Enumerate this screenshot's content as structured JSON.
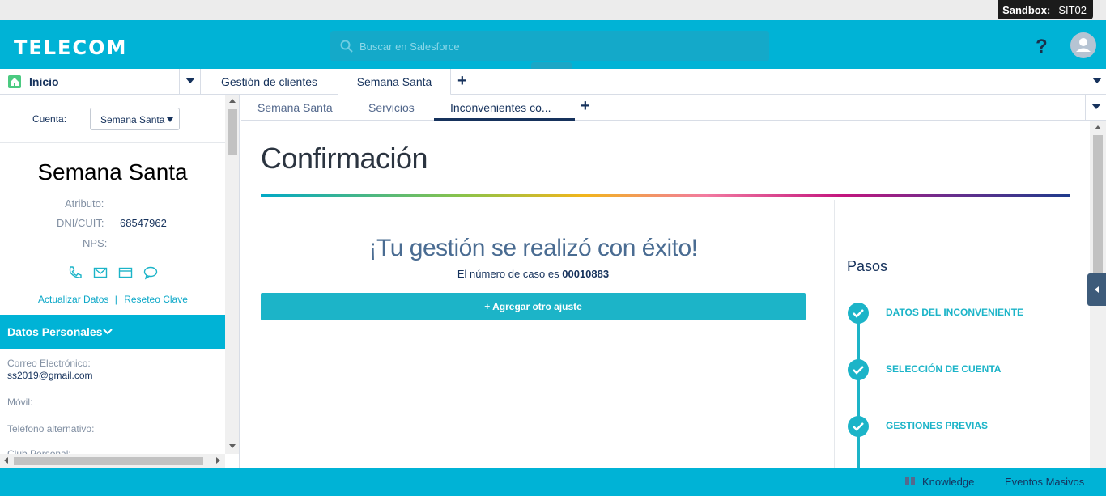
{
  "sandbox": {
    "label": "Sandbox:",
    "name": "SIT02"
  },
  "header": {
    "logo": "TELECOM",
    "search_placeholder": "Buscar en Salesforce",
    "help": "?"
  },
  "main_tabs": [
    {
      "label": "Inicio"
    },
    {
      "label": "Gestión de clientes"
    },
    {
      "label": "Semana Santa"
    }
  ],
  "sub_tabs": [
    {
      "label": "Semana Santa"
    },
    {
      "label": "Servicios"
    },
    {
      "label": "Inconvenientes co..."
    }
  ],
  "left": {
    "account_label": "Cuenta:",
    "account_selected": "Semana Santa",
    "account_name": "Semana Santa",
    "atributo_label": "Atributo:",
    "dni_label": "DNI/CUIT:",
    "dni_value": "68547962",
    "nps_label": "NPS:",
    "link_update": "Actualizar Datos",
    "link_sep": "|",
    "link_reset": "Reseteo Clave",
    "section_title": "Datos Personales",
    "email_label": "Correo Electrónico:",
    "email_value": "ss2019@gmail.com",
    "mobile_label": "Móvil:",
    "alt_phone_label": "Teléfono alternativo:",
    "club_label": "Club Personal:"
  },
  "main": {
    "title": "Confirmación",
    "success": "¡Tu gestión se realizó con éxito!",
    "case_prefix": "El número de caso es",
    "case_number": "00010883",
    "add_button": "+ Agregar otro ajuste"
  },
  "steps": {
    "title": "Pasos",
    "items": [
      {
        "label": "DATOS DEL INCONVENIENTE"
      },
      {
        "label": "SELECCIÓN DE CUENTA"
      },
      {
        "label": "GESTIONES PREVIAS"
      }
    ]
  },
  "footer": {
    "knowledge": "Knowledge",
    "eventos": "Eventos Masivos"
  },
  "colors": {
    "brand": "#00b3d6",
    "accent": "#1cb4c8",
    "text": "#16325c"
  }
}
